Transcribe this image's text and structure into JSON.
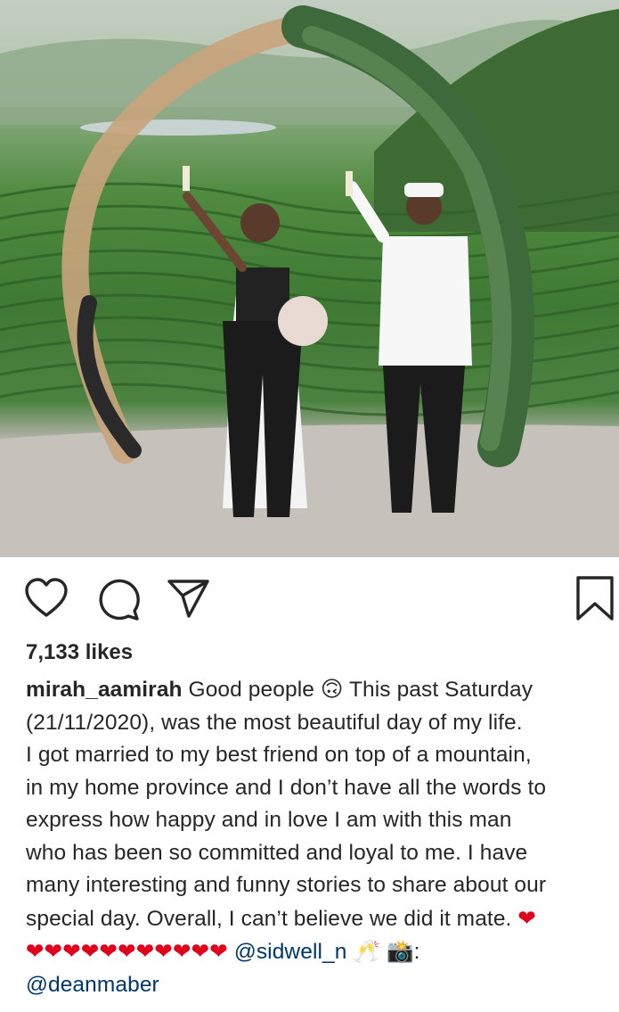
{
  "post": {
    "likes": "7,133 likes",
    "username": "mirah_aamirah",
    "caption_lines": [
      "Good people 🙃 This past Saturday",
      "(21/11/2020), was the most beautiful day of my life.",
      "I got married to my best friend on top of a mountain,",
      "in my home province and I don’t have all the words to",
      "express how happy and in love I am with this man",
      "who has been so committed and loyal to me. I have",
      "many interesting and funny stories to share about our",
      "special day. Overall, I can’t believe we did it mate."
    ],
    "hearts_end_line1": "❤",
    "hearts_line9": "❤❤❤❤❤❤❤❤❤❤❤",
    "mention1": "@sidwell_n",
    "emoji_after_mention": "🥂",
    "camera_emoji": "📸",
    "colon": ":",
    "mention2": "@deanmaber"
  },
  "icons": {
    "like": "heart-outline-icon",
    "comment": "comment-bubble-icon",
    "share": "paper-plane-icon",
    "save": "bookmark-icon"
  },
  "colors": {
    "text": "#262626",
    "mention": "#00376b",
    "heart": "#e0001b"
  }
}
